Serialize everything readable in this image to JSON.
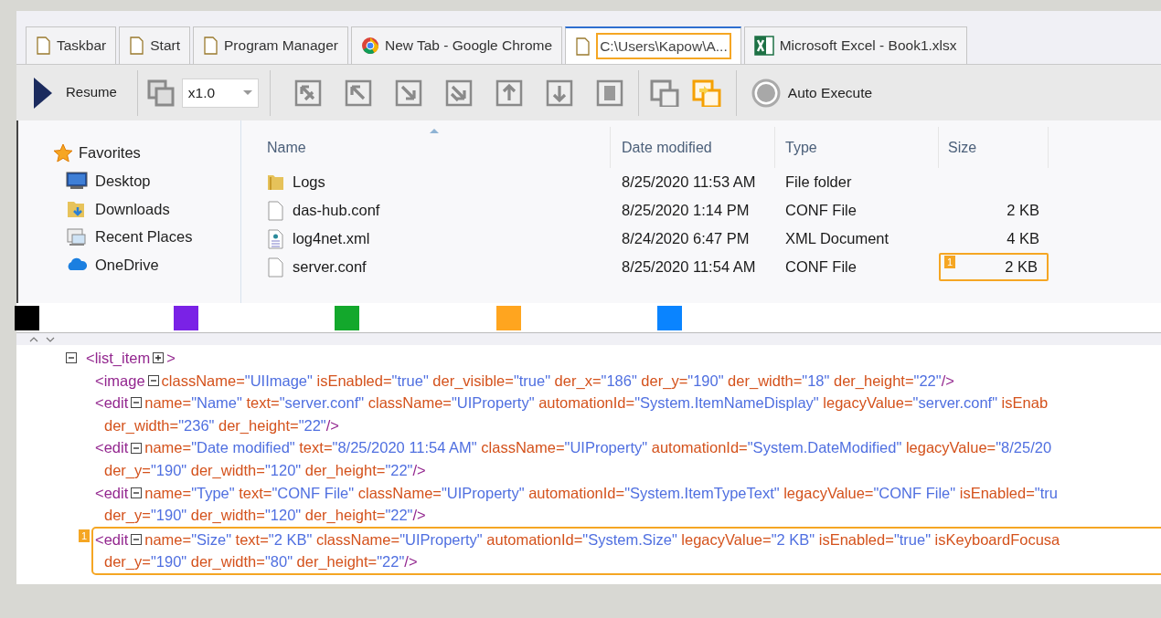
{
  "tabs": [
    {
      "label": "Taskbar",
      "kind": "page",
      "selected": false,
      "highlighted": false
    },
    {
      "label": "Start",
      "kind": "page",
      "selected": false,
      "highlighted": false
    },
    {
      "label": "Program Manager",
      "kind": "page",
      "selected": false,
      "highlighted": false
    },
    {
      "label": "New Tab - Google Chrome",
      "kind": "browser",
      "selected": false,
      "highlighted": false
    },
    {
      "label": "C:\\Users\\Kapow\\A...",
      "kind": "page",
      "selected": true,
      "highlighted": true
    },
    {
      "label": "Microsoft Excel - Book1.xlsx",
      "kind": "spreadsheet",
      "selected": false,
      "highlighted": false
    }
  ],
  "toolbar": {
    "resume": "Resume",
    "speed": "x1.0",
    "auto_execute": {
      "label": "Auto Execute",
      "on": false
    }
  },
  "navigation": {
    "favorites": "Favorites",
    "items": [
      {
        "label": "Desktop",
        "kind": "desktop"
      },
      {
        "label": "Downloads",
        "kind": "downloads"
      },
      {
        "label": "Recent Places",
        "kind": "recent"
      },
      {
        "label": "OneDrive",
        "kind": "cloud"
      }
    ]
  },
  "files": {
    "columns": [
      "Name",
      "Date modified",
      "Type",
      "Size"
    ],
    "rows": [
      {
        "kind": "folder",
        "name": "Logs",
        "date": "8/25/2020 11:53 AM",
        "type": "File folder",
        "highlighted": false
      },
      {
        "kind": "file",
        "name": "das-hub.conf",
        "date": "8/25/2020 1:14 PM",
        "type": "CONF File",
        "size": "2 KB",
        "highlighted": false
      },
      {
        "kind": "xml",
        "name": "log4net.xml",
        "date": "8/24/2020 6:47 PM",
        "type": "XML Document",
        "size": "4 KB",
        "highlighted": false
      },
      {
        "kind": "file",
        "name": "server.conf",
        "date": "8/25/2020 11:54 AM",
        "type": "CONF File",
        "size": "2 KB",
        "highlighted": true,
        "badge": "1"
      }
    ]
  },
  "color_swatches": [
    {
      "color": "#000000"
    },
    {
      "color": "#7a22e6"
    },
    {
      "color": "#13a82c"
    },
    {
      "color": "#ffa51f"
    },
    {
      "color": "#0a84ff"
    }
  ],
  "xml_tree": [
    {
      "expanded": true,
      "highlighted": false,
      "lines": [
        [
          {
            "kind": "tag",
            "text": "<list_item"
          },
          {
            "kind": "toggle",
            "expanded": false
          },
          {
            "kind": "tag",
            "text": ">"
          }
        ]
      ],
      "children": [
        {
          "highlighted": false,
          "lines": [
            [
              {
                "kind": "tag",
                "text": "<image"
              },
              {
                "kind": "toggle",
                "expanded": true
              },
              {
                "kind": "attr",
                "text": "className="
              },
              {
                "kind": "value",
                "text": "\"UIImage\""
              },
              {
                "kind": "attr",
                "text": " isEnabled="
              },
              {
                "kind": "value",
                "text": "\"true\""
              },
              {
                "kind": "attr",
                "text": " der_visible="
              },
              {
                "kind": "value",
                "text": "\"true\""
              },
              {
                "kind": "attr",
                "text": " der_x="
              },
              {
                "kind": "value",
                "text": "\"186\""
              },
              {
                "kind": "attr",
                "text": " der_y="
              },
              {
                "kind": "value",
                "text": "\"190\""
              },
              {
                "kind": "attr",
                "text": " der_width="
              },
              {
                "kind": "value",
                "text": "\"18\""
              },
              {
                "kind": "attr",
                "text": " der_height="
              },
              {
                "kind": "value",
                "text": "\"22\""
              },
              {
                "kind": "tag",
                "text": "/>"
              }
            ]
          ]
        },
        {
          "highlighted": false,
          "lines": [
            [
              {
                "kind": "tag",
                "text": "<edit"
              },
              {
                "kind": "toggle",
                "expanded": true
              },
              {
                "kind": "attr",
                "text": "name="
              },
              {
                "kind": "value",
                "text": "\"Name\""
              },
              {
                "kind": "attr",
                "text": " text="
              },
              {
                "kind": "value",
                "text": "\"server.conf\""
              },
              {
                "kind": "attr",
                "text": " className="
              },
              {
                "kind": "value",
                "text": "\"UIProperty\""
              },
              {
                "kind": "attr",
                "text": " automationId="
              },
              {
                "kind": "value",
                "text": "\"System.ItemNameDisplay\""
              },
              {
                "kind": "attr",
                "text": " legacyValue="
              },
              {
                "kind": "value",
                "text": "\"server.conf\""
              },
              {
                "kind": "attr",
                "text": " isEnab"
              }
            ],
            [
              {
                "kind": "attr",
                "text": "der_width="
              },
              {
                "kind": "value",
                "text": "\"236\""
              },
              {
                "kind": "attr",
                "text": " der_height="
              },
              {
                "kind": "value",
                "text": "\"22\""
              },
              {
                "kind": "tag",
                "text": "/>"
              }
            ]
          ]
        },
        {
          "highlighted": false,
          "lines": [
            [
              {
                "kind": "tag",
                "text": "<edit"
              },
              {
                "kind": "toggle",
                "expanded": true
              },
              {
                "kind": "attr",
                "text": "name="
              },
              {
                "kind": "value",
                "text": "\"Date modified\""
              },
              {
                "kind": "attr",
                "text": " text="
              },
              {
                "kind": "value",
                "text": "\"8/25/2020 11:54 AM\""
              },
              {
                "kind": "attr",
                "text": " className="
              },
              {
                "kind": "value",
                "text": "\"UIProperty\""
              },
              {
                "kind": "attr",
                "text": " automationId="
              },
              {
                "kind": "value",
                "text": "\"System.DateModified\""
              },
              {
                "kind": "attr",
                "text": " legacyValue="
              },
              {
                "kind": "value",
                "text": "\"8/25/20"
              }
            ],
            [
              {
                "kind": "attr",
                "text": "der_y="
              },
              {
                "kind": "value",
                "text": "\"190\""
              },
              {
                "kind": "attr",
                "text": " der_width="
              },
              {
                "kind": "value",
                "text": "\"120\""
              },
              {
                "kind": "attr",
                "text": " der_height="
              },
              {
                "kind": "value",
                "text": "\"22\""
              },
              {
                "kind": "tag",
                "text": "/>"
              }
            ]
          ]
        },
        {
          "highlighted": false,
          "lines": [
            [
              {
                "kind": "tag",
                "text": "<edit"
              },
              {
                "kind": "toggle",
                "expanded": true
              },
              {
                "kind": "attr",
                "text": "name="
              },
              {
                "kind": "value",
                "text": "\"Type\""
              },
              {
                "kind": "attr",
                "text": " text="
              },
              {
                "kind": "value",
                "text": "\"CONF File\""
              },
              {
                "kind": "attr",
                "text": " className="
              },
              {
                "kind": "value",
                "text": "\"UIProperty\""
              },
              {
                "kind": "attr",
                "text": " automationId="
              },
              {
                "kind": "value",
                "text": "\"System.ItemTypeText\""
              },
              {
                "kind": "attr",
                "text": " legacyValue="
              },
              {
                "kind": "value",
                "text": "\"CONF File\""
              },
              {
                "kind": "attr",
                "text": " isEnabled="
              },
              {
                "kind": "value",
                "text": "\"tru"
              }
            ],
            [
              {
                "kind": "attr",
                "text": "der_y="
              },
              {
                "kind": "value",
                "text": "\"190\""
              },
              {
                "kind": "attr",
                "text": " der_width="
              },
              {
                "kind": "value",
                "text": "\"120\""
              },
              {
                "kind": "attr",
                "text": " der_height="
              },
              {
                "kind": "value",
                "text": "\"22\""
              },
              {
                "kind": "tag",
                "text": "/>"
              }
            ]
          ]
        },
        {
          "highlighted": true,
          "badge": "1",
          "lines": [
            [
              {
                "kind": "tag",
                "text": "<edit"
              },
              {
                "kind": "toggle",
                "expanded": true
              },
              {
                "kind": "attr",
                "text": "name="
              },
              {
                "kind": "value",
                "text": "\"Size\""
              },
              {
                "kind": "attr",
                "text": " text="
              },
              {
                "kind": "value",
                "text": "\"2 KB\""
              },
              {
                "kind": "attr",
                "text": " className="
              },
              {
                "kind": "value",
                "text": "\"UIProperty\""
              },
              {
                "kind": "attr",
                "text": " automationId="
              },
              {
                "kind": "value",
                "text": "\"System.Size\""
              },
              {
                "kind": "attr",
                "text": " legacyValue="
              },
              {
                "kind": "value",
                "text": "\"2 KB\""
              },
              {
                "kind": "attr",
                "text": " isEnabled="
              },
              {
                "kind": "value",
                "text": "\"true\""
              },
              {
                "kind": "attr",
                "text": " isKeyboardFocusa"
              }
            ],
            [
              {
                "kind": "attr",
                "text": "der_y="
              },
              {
                "kind": "value",
                "text": "\"190\""
              },
              {
                "kind": "attr",
                "text": " der_width="
              },
              {
                "kind": "value",
                "text": "\"80\""
              },
              {
                "kind": "attr",
                "text": " der_height="
              },
              {
                "kind": "value",
                "text": "\"22\""
              },
              {
                "kind": "tag",
                "text": "/>"
              }
            ]
          ]
        }
      ]
    }
  ]
}
